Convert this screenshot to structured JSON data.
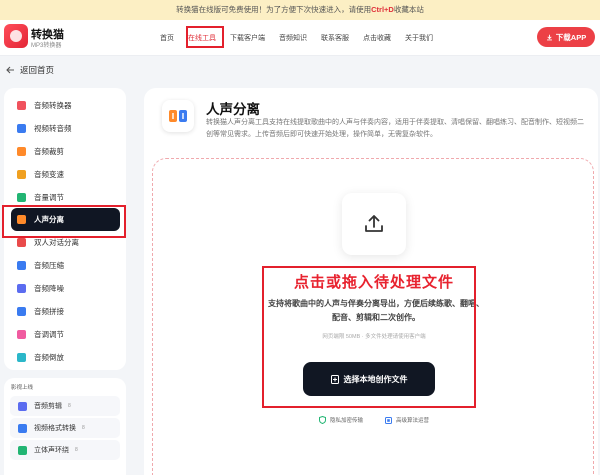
{
  "notice": {
    "before": "转换猫在线版可免费使用！为了方便下次快速进入，请使用",
    "shortcut": "Ctrl+D",
    "after": "收藏本站"
  },
  "header": {
    "logo_title": "转换猫",
    "logo_sub": "MP3转换器",
    "nav": [
      "首页",
      "在线工具",
      "下载客户端",
      "音频知识",
      "联系客服",
      "点击收藏",
      "关于我们"
    ],
    "download_label": "下载APP"
  },
  "back_label": "返回首页",
  "sidebar": {
    "items": [
      {
        "label": "音频转换器",
        "color": "#f0525d"
      },
      {
        "label": "视频转音频",
        "color": "#3a7bf0"
      },
      {
        "label": "音频裁剪",
        "color": "#ff8a2a"
      },
      {
        "label": "音频变速",
        "color": "#f0a020"
      },
      {
        "label": "音量调节",
        "color": "#22b573"
      },
      {
        "label": "人声分离",
        "color": "#ff8a2a"
      },
      {
        "label": "双人对话分离",
        "color": "#e94b4b"
      },
      {
        "label": "音频压缩",
        "color": "#3a7bf0"
      },
      {
        "label": "音频降噪",
        "color": "#5b6cf0"
      },
      {
        "label": "音频拼接",
        "color": "#3a7bf0"
      },
      {
        "label": "音调调节",
        "color": "#f05ba0"
      },
      {
        "label": "音频倒放",
        "color": "#2bb7c9"
      }
    ],
    "active_index": 5
  },
  "sidebar2": {
    "title": "影视上线",
    "items": [
      {
        "label": "音频剪辑",
        "badge": "8",
        "color": "#5b6cf0"
      },
      {
        "label": "视频格式转换",
        "badge": "8",
        "color": "#3a7bf0"
      },
      {
        "label": "立体声环绕",
        "badge": "8",
        "color": "#22b573"
      }
    ]
  },
  "tool": {
    "title": "人声分离",
    "description": "转换猫人声分离工具支持在线提取歌曲中的人声与伴奏内容，适用于伴奏提取、清唱保留、翻唱练习、配音制作、短视频二创等常见需求。上传音频后即可快速开始处理，操作简单，无需复杂软件。"
  },
  "dropzone": {
    "title": "点击或拖入待处理文件",
    "description": "支持将歌曲中的人声与伴奏分离导出，方便后续练歌、翻唱、配音、剪辑和二次创作。",
    "limit": "网页端限 50MB · 多文件处理请使用客户端",
    "button_label": "选择本地创作文件",
    "features": [
      "隐私加密传输",
      "高级算法运营"
    ]
  },
  "colors": {
    "accent": "#e8232f",
    "dark": "#111723"
  }
}
